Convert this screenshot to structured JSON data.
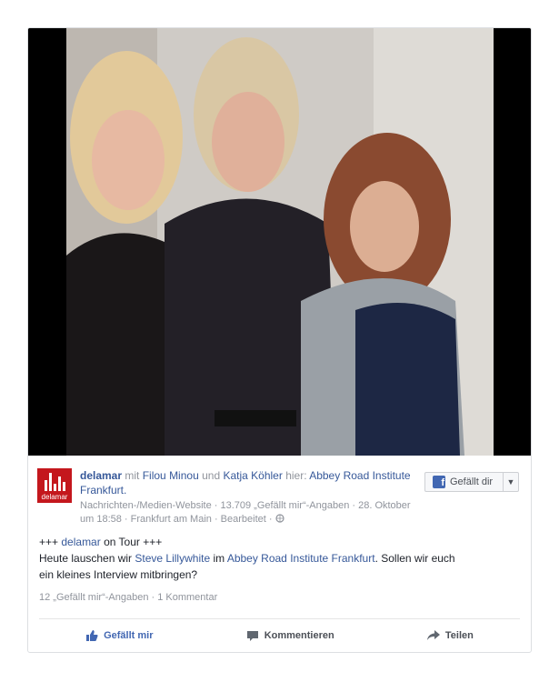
{
  "post": {
    "page_name": "delamar",
    "with_text": "mit",
    "tagged_1": "Filou Minou",
    "and_text": "und",
    "tagged_2": "Katja Köhler",
    "here_text": "hier:",
    "location": "Abbey Road Institute Frankfurt.",
    "meta_line_1": "Nachrichten-/Medien-Website · 13.709 „Gefällt mir“-Angaben · 28. Oktober",
    "meta_line_2": "um 18:58 · Frankfurt am Main · Bearbeitet ·",
    "like_page_button": "Gefällt dir",
    "avatar_brand": "delamar",
    "body_prefix": "+++",
    "body_page": "delamar",
    "body_tour": "on Tour +++",
    "body_l2_a": "Heute lauschen wir",
    "body_person": "Steve Lillywhite",
    "body_l2_b": "im",
    "body_place": "Abbey Road Institute Frankfurt",
    "body_l2_c": ". Sollen wir euch",
    "body_l3": "ein kleines Interview mitbringen?",
    "stats": "12 „Gefällt mir“-Angaben · 1 Kommentar"
  },
  "actions": {
    "like": "Gefällt mir",
    "comment": "Kommentieren",
    "share": "Teilen"
  },
  "colors": {
    "link": "#365899",
    "brand_red": "#c4171d",
    "fb_blue": "#4267b2"
  }
}
